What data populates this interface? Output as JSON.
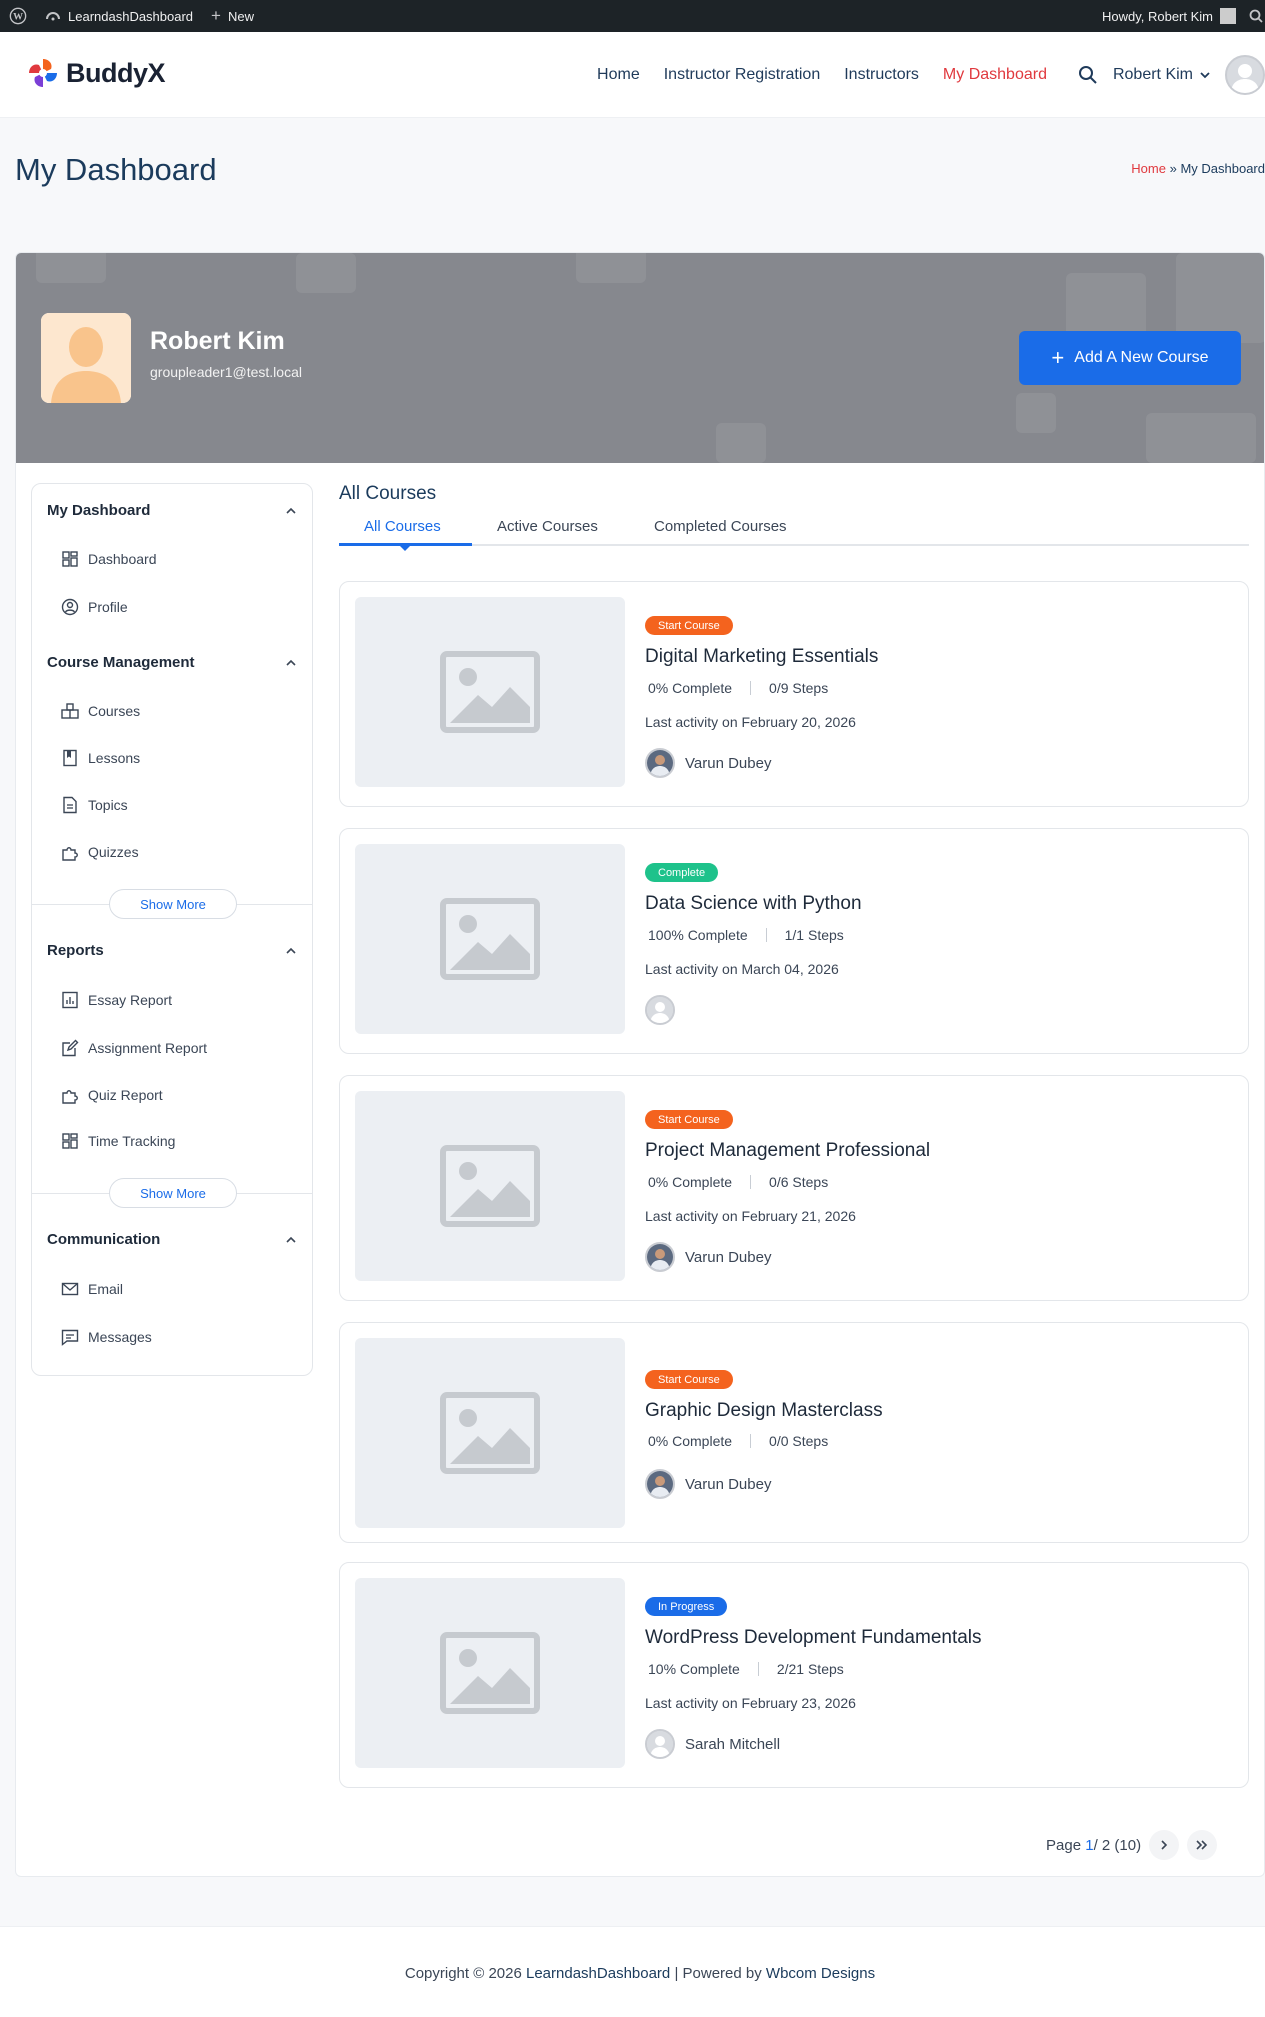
{
  "adminbar": {
    "site_name": "LearndashDashboard",
    "new_label": "New",
    "howdy": "Howdy, Robert Kim"
  },
  "header": {
    "logo_text": "BuddyX",
    "nav": [
      "Home",
      "Instructor Registration",
      "Instructors",
      "My Dashboard"
    ],
    "active_nav": "My Dashboard",
    "user_name": "Robert Kim"
  },
  "page": {
    "title": "My Dashboard",
    "breadcrumb_home": "Home",
    "breadcrumb_sep": "»",
    "breadcrumb_current": "My Dashboard"
  },
  "profile": {
    "name": "Robert Kim",
    "email": "groupleader1@test.local",
    "add_course_label": "Add A New Course"
  },
  "sidebar": {
    "sections": [
      {
        "title": "My Dashboard",
        "items": [
          "Dashboard",
          "Profile"
        ]
      },
      {
        "title": "Course Management",
        "items": [
          "Courses",
          "Lessons",
          "Topics",
          "Quizzes"
        ],
        "show_more": "Show More"
      },
      {
        "title": "Reports",
        "items": [
          "Essay Report",
          "Assignment Report",
          "Quiz Report",
          "Time Tracking"
        ],
        "show_more": "Show More"
      },
      {
        "title": "Communication",
        "items": [
          "Email",
          "Messages"
        ]
      }
    ]
  },
  "content": {
    "title": "All Courses",
    "tabs": [
      "All Courses",
      "Active Courses",
      "Completed Courses"
    ],
    "active_tab": "All Courses"
  },
  "courses": [
    {
      "badge": "Start Course",
      "badge_color": "#f4631e",
      "title": "Digital Marketing Essentials",
      "complete": "0% Complete",
      "steps": "0/9 Steps",
      "activity": "Last activity on February 20, 2026",
      "instructor": "Varun Dubey"
    },
    {
      "badge": "Complete",
      "badge_color": "#1ec28b",
      "title": "Data Science with Python",
      "complete": "100% Complete",
      "steps": "1/1 Steps",
      "activity": "Last activity on March 04, 2026",
      "instructor": ""
    },
    {
      "badge": "Start Course",
      "badge_color": "#f4631e",
      "title": "Project Management Professional",
      "complete": "0% Complete",
      "steps": "0/6 Steps",
      "activity": "Last activity on February 21, 2026",
      "instructor": "Varun Dubey"
    },
    {
      "badge": "Start Course",
      "badge_color": "#f4631e",
      "title": "Graphic Design Masterclass",
      "complete": "0% Complete",
      "steps": "0/0 Steps",
      "activity": "",
      "instructor": "Varun Dubey"
    },
    {
      "badge": "In Progress",
      "badge_color": "#1a6ce8",
      "title": "WordPress Development Fundamentals",
      "complete": "10% Complete",
      "steps": "2/21 Steps",
      "activity": "Last activity on February 23, 2026",
      "instructor": "Sarah Mitchell"
    }
  ],
  "pagination": {
    "page_label": "Page",
    "current": "1",
    "rest": " / 2 (10)"
  },
  "footer": {
    "prefix": "Copyright © 2026 ",
    "site": "LearndashDashboard",
    "middle": " | Powered by ",
    "powered": "Wbcom Designs"
  },
  "colors": {
    "accent": "#1a6ce8",
    "nav_active": "#e0393e",
    "heading": "#1b3b5c"
  }
}
